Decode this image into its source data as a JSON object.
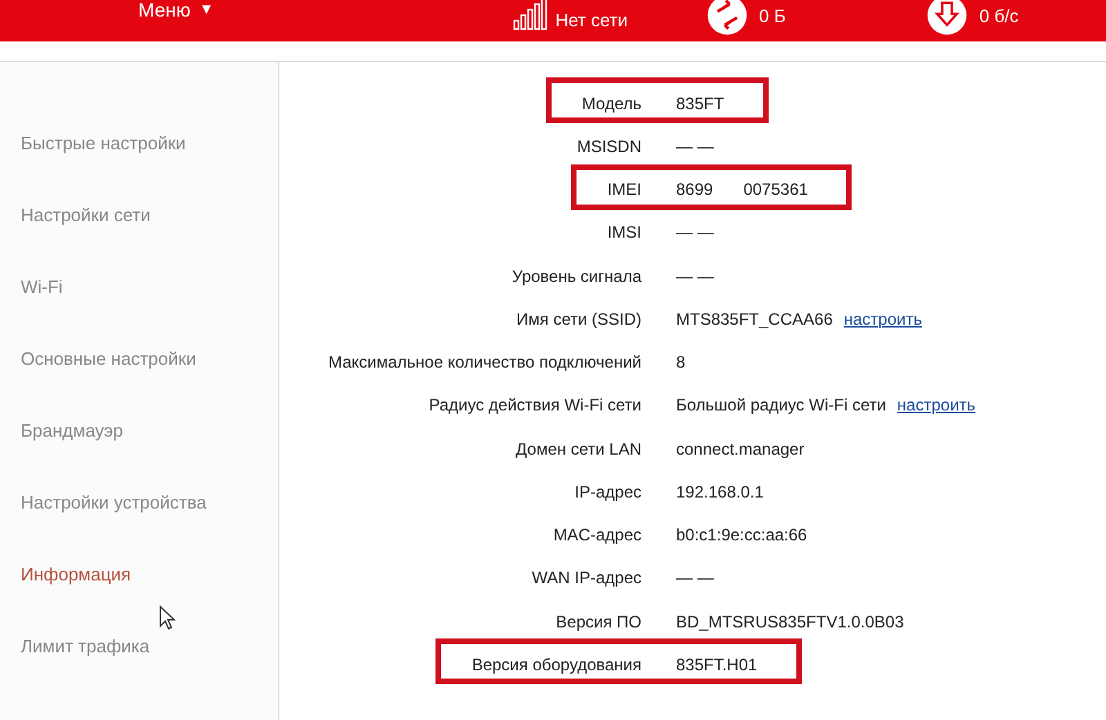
{
  "header": {
    "menu": "Меню",
    "menu_caret": "▼",
    "network_status": "Нет сети",
    "traffic": {
      "value": "0 Б"
    },
    "speed": {
      "value": "0 б/с"
    }
  },
  "sidebar": {
    "items": [
      {
        "label": "Быстрые настройки",
        "selected": false
      },
      {
        "label": "Настройки сети",
        "selected": false
      },
      {
        "label": "Wi-Fi",
        "selected": false
      },
      {
        "label": "Основные настройки",
        "selected": false
      },
      {
        "label": "Брандмауэр",
        "selected": false
      },
      {
        "label": "Настройки устройства",
        "selected": false
      },
      {
        "label": "Информация",
        "selected": true
      },
      {
        "label": "Лимит трафика",
        "selected": false
      }
    ]
  },
  "info": {
    "rows": [
      {
        "label": "Модель",
        "value": "835FT",
        "highlighted": true
      },
      {
        "label": "MSISDN",
        "value": "— —",
        "highlighted": false
      },
      {
        "label": "IMEI",
        "value": "8699",
        "value_2": "0075361",
        "highlighted": true
      },
      {
        "label": "IMSI",
        "value": "— —",
        "highlighted": false
      },
      {
        "label": "Уровень сигнала",
        "value": "— —",
        "highlighted": false
      },
      {
        "label": "Имя сети (SSID)",
        "value": "MTS835FT_CCAA66",
        "link": "настроить",
        "highlighted": false
      },
      {
        "label": "Максимальное количество подключений",
        "value": "8",
        "highlighted": false
      },
      {
        "label": "Радиус действия Wi-Fi сети",
        "value": "Большой радиус Wi-Fi сети",
        "link": "настроить",
        "highlighted": false
      },
      {
        "label": "Домен сети LAN",
        "value": "connect.manager",
        "highlighted": false
      },
      {
        "label": "IP-адрес",
        "value": "192.168.0.1",
        "highlighted": false
      },
      {
        "label": "MAC-адрес",
        "value": "b0:c1:9e:cc:aa:66",
        "highlighted": false
      },
      {
        "label": "WAN IP-адрес",
        "value": "— —",
        "highlighted": false
      },
      {
        "label": "Версия ПО",
        "value": "BD_MTSRUS835FTV1.0.0B03",
        "highlighted": false
      },
      {
        "label": "Версия оборудования",
        "value": "835FT.H01",
        "highlighted": true
      }
    ]
  }
}
